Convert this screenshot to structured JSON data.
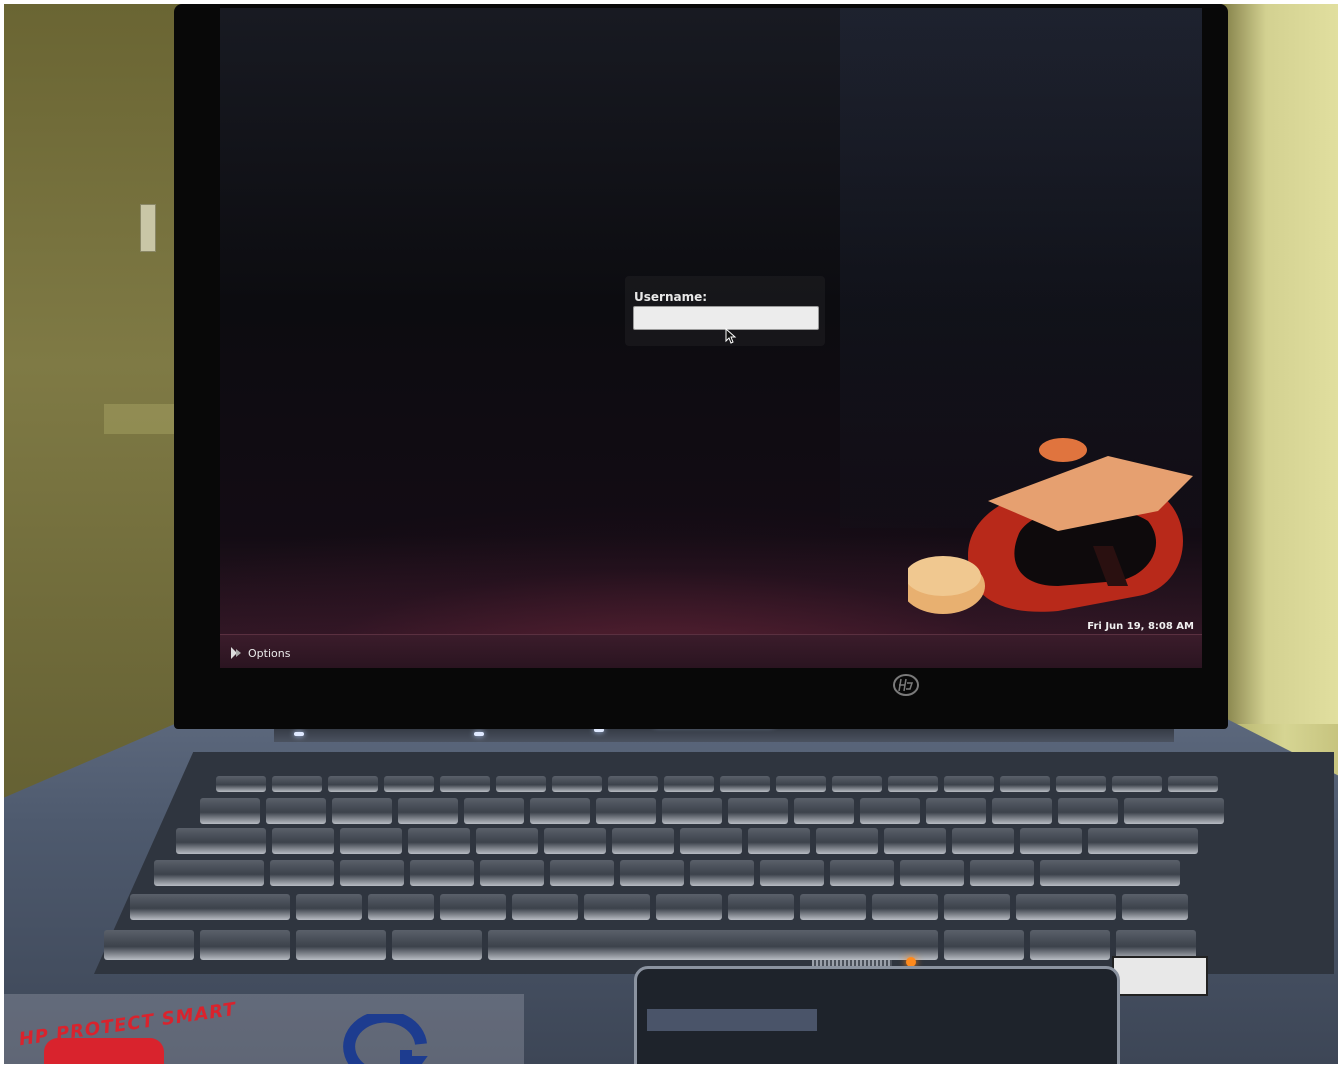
{
  "login": {
    "username_label": "Username:",
    "username_value": ""
  },
  "taskbar": {
    "options_label": "Options",
    "clock": "Fri Jun 19, 8:08 AM"
  },
  "photo_text": {
    "sticker_label": "HP PROTECT SMART"
  },
  "colors": {
    "ubuntu_orange": "#e05a28",
    "ubuntu_red": "#b8291a",
    "screen_bottom_glow": "#3a1a2a"
  },
  "icons": {
    "options": "options-icon",
    "cursor": "mouse-cursor-icon",
    "logo": "ubuntu-logo",
    "brand": "hp-logo"
  }
}
